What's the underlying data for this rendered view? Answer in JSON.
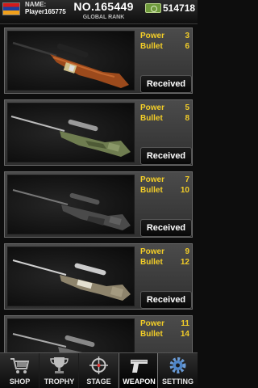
{
  "header": {
    "flag_icon": "armenia-flag-icon",
    "name_label": "NAME:",
    "player_name": "Player165775",
    "rank_number": "NO.165449",
    "rank_label": "GLOBAL RANK",
    "cash_icon": "cash-icon",
    "cash": "514718"
  },
  "colors": {
    "stat_yellow": "#f2cd28",
    "card_bg": "#3c3c3c"
  },
  "weapons": [
    {
      "icon": "bolt-rifle-wood-icon",
      "power_label": "Power",
      "power": "3",
      "bullet_label": "Bullet",
      "bullet": "6",
      "button": "Received"
    },
    {
      "icon": "sniper-rifle-camo-icon",
      "power_label": "Power",
      "power": "5",
      "bullet_label": "Bullet",
      "bullet": "8",
      "button": "Received"
    },
    {
      "icon": "sniper-rifle-black-icon",
      "power_label": "Power",
      "power": "7",
      "bullet_label": "Bullet",
      "bullet": "10",
      "button": "Received"
    },
    {
      "icon": "sniper-rifle-tan-icon",
      "power_label": "Power",
      "power": "9",
      "bullet_label": "Bullet",
      "bullet": "12",
      "button": "Received"
    },
    {
      "icon": "sniper-rifle-grey-icon",
      "power_label": "Power",
      "power": "11",
      "bullet_label": "Bullet",
      "bullet": "14"
    }
  ],
  "nav": {
    "items": [
      {
        "label": "SHOP",
        "icon": "shopping-cart-icon"
      },
      {
        "label": "TROPHY",
        "icon": "trophy-icon"
      },
      {
        "label": "STAGE",
        "icon": "crosshair-icon"
      },
      {
        "label": "WEAPON",
        "icon": "pistol-icon",
        "active": true
      },
      {
        "label": "SETTING",
        "icon": "gear-icon"
      }
    ]
  }
}
